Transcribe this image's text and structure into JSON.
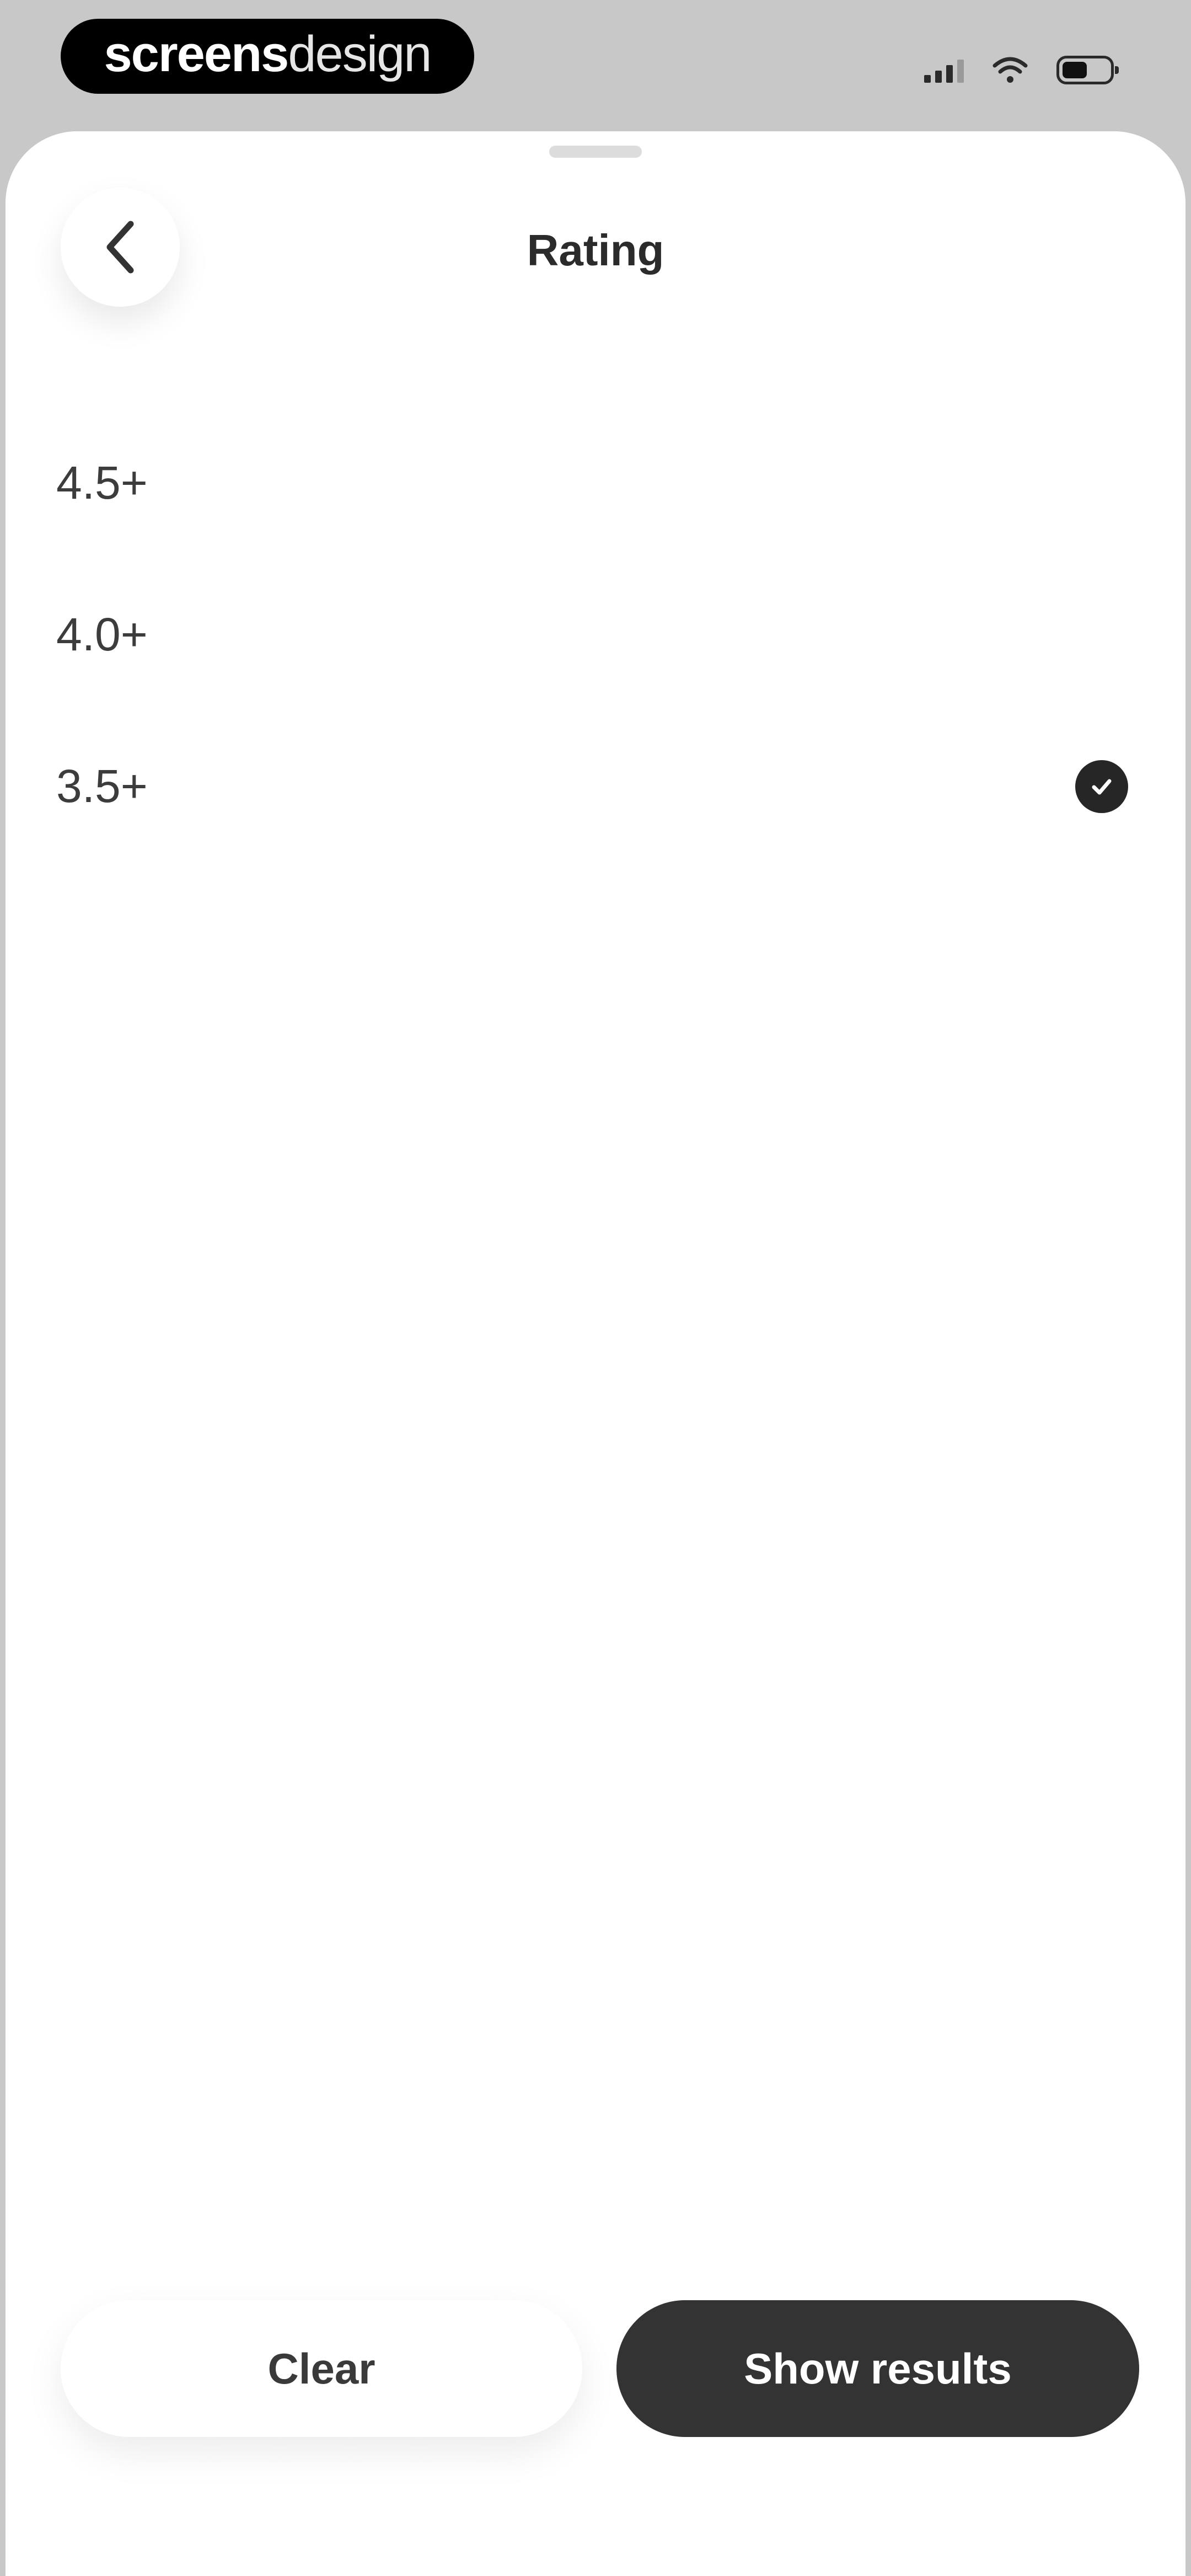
{
  "status_bar": {
    "brand_part1": "screens",
    "brand_part2": "design"
  },
  "header": {
    "title": "Rating"
  },
  "ratings": [
    {
      "label": "4.5+",
      "selected": false
    },
    {
      "label": "4.0+",
      "selected": false
    },
    {
      "label": "3.5+",
      "selected": true
    }
  ],
  "footer": {
    "clear_label": "Clear",
    "show_results_label": "Show results"
  },
  "colors": {
    "primary_button": "#333333",
    "check": "#262626",
    "status_bar_bg": "#c8c8c8"
  },
  "icons": {
    "back": "chevron-left-icon",
    "selected": "check-circle-icon",
    "signal": "cellular-signal-icon",
    "wifi": "wifi-icon",
    "battery": "battery-icon"
  }
}
